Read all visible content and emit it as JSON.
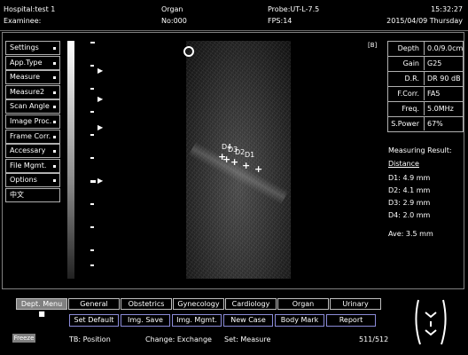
{
  "header": {
    "hospital": "Hospital:test 1",
    "examinee": "Examinee:",
    "organ": "Organ",
    "no": "No:000",
    "probe": "Probe:UT-L-7.5",
    "fps": "FPS:14",
    "time": "15:32:27",
    "date": "2015/04/09 Thursday"
  },
  "menu": [
    {
      "label": "Settings"
    },
    {
      "label": "App.Type"
    },
    {
      "label": "Measure"
    },
    {
      "label": "Measure2"
    },
    {
      "label": "Scan Angle"
    },
    {
      "label": "Image Proc."
    },
    {
      "label": "Frame Corr."
    },
    {
      "label": "Accessary"
    },
    {
      "label": "File Mgmt."
    },
    {
      "label": "Options"
    },
    {
      "label": "中文"
    }
  ],
  "image": {
    "marker": "[B]",
    "point_labels": [
      "D4",
      "D3",
      "D2",
      "D1"
    ]
  },
  "params": [
    {
      "key": "Depth",
      "value": "0.0/9.0cm"
    },
    {
      "key": "Gain",
      "value": "G25"
    },
    {
      "key": "D.R.",
      "value": "DR 90 dB"
    },
    {
      "key": "F.Corr.",
      "value": "FA5"
    },
    {
      "key": "Freq.",
      "value": "5.0MHz"
    },
    {
      "key": "S.Power",
      "value": "67%"
    }
  ],
  "measuring": {
    "title": "Measuring Result:",
    "subtitle": "Distance",
    "items": [
      "D1: 4.9 mm",
      "D2: 4.1 mm",
      "D3: 2.9 mm",
      "D4: 2.0 mm"
    ],
    "average": "Ave: 3.5 mm"
  },
  "tabs": [
    "Dept. Menu",
    "General",
    "Obstetrics",
    "Gynecology",
    "Cardiology",
    "Organ",
    "Urinary"
  ],
  "buttons": [
    "Set Default",
    "Img. Save",
    "Img. Mgmt.",
    "New Case",
    "Body Mark",
    "Report"
  ],
  "footer": {
    "freeze": "Freeze",
    "tb": "TB: Position",
    "change": "Change: Exchange",
    "set": "Set: Measure",
    "frames": "511/512"
  }
}
